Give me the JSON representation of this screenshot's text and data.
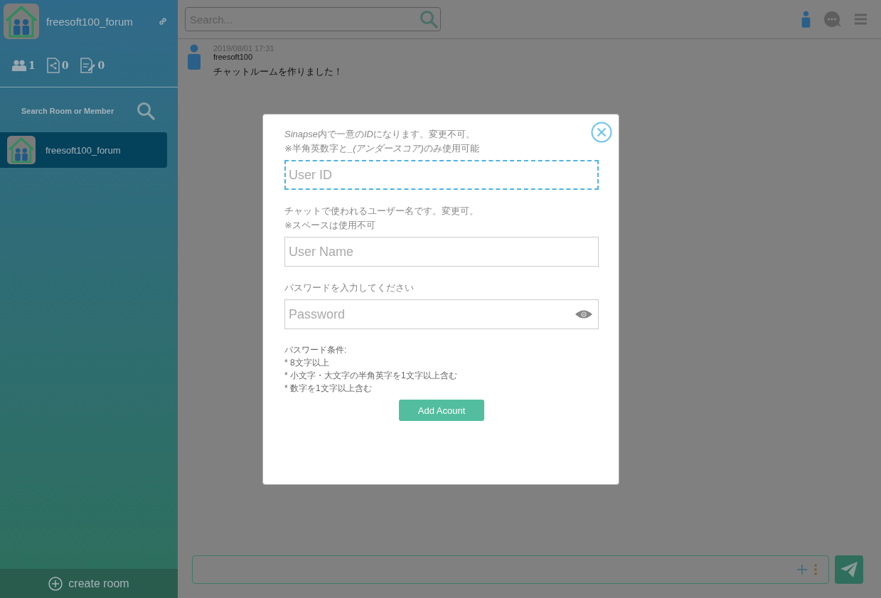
{
  "sidebar": {
    "room_title": "freesoft100_forum",
    "stats": [
      {
        "kind": "members",
        "count": "1"
      },
      {
        "kind": "shared",
        "count": "0"
      },
      {
        "kind": "notes",
        "count": "0"
      }
    ],
    "search_label": "Search Room or Member",
    "rooms": [
      {
        "name": "freesoft100_forum",
        "selected": true
      }
    ],
    "create_room": "create room"
  },
  "header": {
    "search_placeholder": "Search..."
  },
  "messages": [
    {
      "time": "2019/08/01 17:31",
      "author": "freesoft100",
      "text": "チャットルームを作りました！"
    }
  ],
  "dialog": {
    "fields": [
      {
        "kind": "text",
        "hint": [
          [
            {
              "text": "Sinapse",
              "italic": true
            },
            {
              "text": "内で一意の",
              "italic": false
            },
            {
              "text": "ID",
              "italic": true
            },
            {
              "text": "になります。変更不可。",
              "italic": false
            }
          ],
          [
            {
              "text": "※半角英数字と",
              "italic": false
            },
            {
              "text": "_(アンダースコア)",
              "italic": true
            },
            {
              "text": "のみ使用可能",
              "italic": false
            }
          ]
        ],
        "placeholder": "User ID",
        "focused": true
      },
      {
        "kind": "text",
        "hint": [
          [
            {
              "text": "チャットで使われるユーザー名です。変更可。",
              "italic": false
            }
          ],
          [
            {
              "text": "※スペースは使用不可",
              "italic": false
            }
          ]
        ],
        "placeholder": "User Name",
        "focused": false
      },
      {
        "kind": "password",
        "hint": [
          [
            {
              "text": "パスワードを入力してください",
              "italic": false
            }
          ]
        ],
        "placeholder": "Password",
        "focused": false
      }
    ],
    "conditions": [
      "パスワード条件:",
      "* 8文字以上",
      "* 小文字・大文字の半角英字を1文字以上含む",
      "* 数字を1文字以上含む"
    ],
    "button": "Add Acount"
  }
}
